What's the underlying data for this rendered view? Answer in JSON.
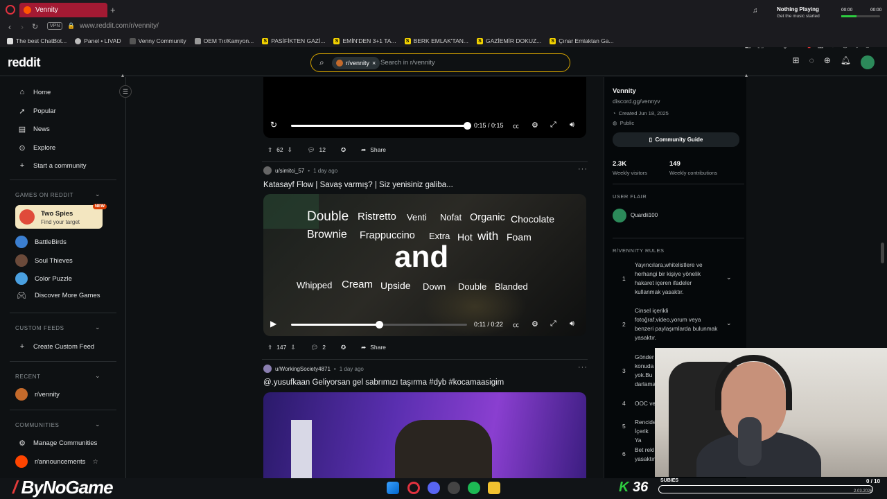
{
  "browser": {
    "tab_title": "Vennity",
    "url": "www.reddit.com/r/vennity/",
    "vpn": "VPN",
    "bookmarks": [
      "The best ChatBot...",
      "Panel • LIVAD",
      "Venny Community",
      "OEM Tır/Kamyon...",
      "PASİFİKTEN GAZİ...",
      "EMİN'DEN 3+1 TA...",
      "BERK EMLAK'TAN...",
      "GAZİEMİR DOKUZ...",
      "Çınar Emlaktan Ga..."
    ],
    "music_title": "Nothing Playing",
    "music_sub": "Get the music started",
    "music_time_left": "00:00",
    "music_time_right": "00:00"
  },
  "header": {
    "logo": "reddit",
    "search_chip": "r/vennity",
    "search_placeholder": "Search in r/vennity"
  },
  "sidebar": {
    "items": [
      "Home",
      "Popular",
      "News",
      "Explore",
      "Start a community"
    ],
    "games_header": "GAMES ON REDDIT",
    "featured_game": {
      "title": "Two Spies",
      "subtitle": "Find your target",
      "badge": "NEW"
    },
    "games": [
      "BattleBirds",
      "Soul Thieves",
      "Color Puzzle",
      "Discover More Games"
    ],
    "custom_feeds_header": "CUSTOM FEEDS",
    "create_custom_feed": "Create Custom Feed",
    "recent_header": "RECENT",
    "recent": [
      "r/vennity"
    ],
    "communities_header": "COMMUNITIES",
    "communities": [
      "Manage Communities",
      "r/announcements"
    ]
  },
  "posts": [
    {
      "video_time": "0:15 / 0:15",
      "progress": 1.0,
      "upvotes": "62",
      "comments": "12",
      "share": "Share"
    },
    {
      "author": "u/simitci_57",
      "time": "1 day ago",
      "title": "Katasayf Flow | Savaş varmış? | Siz yenisiniz galiba...",
      "video_words": {
        "row1": [
          "Double",
          "Ristretto",
          "Venti",
          "Nofat",
          "Organic",
          "Chocolate"
        ],
        "row2": [
          "Brownie",
          "Frappuccino",
          "Extra",
          "Hot",
          "with",
          "Foam"
        ],
        "center": "and",
        "row3": [
          "Whipped",
          "Cream",
          "Upside",
          "Down",
          "Double",
          "Blanded"
        ]
      },
      "video_time": "0:11 / 0:22",
      "progress": 0.5,
      "upvotes": "147",
      "comments": "2",
      "share": "Share"
    },
    {
      "author": "u/WorkingSociety4871",
      "time": "1 day ago",
      "title": "@.yusufkaan Geliyorsan gel sabrımızı taşırma #dyb #kocamaasigim"
    }
  ],
  "community": {
    "name": "Vennity",
    "link": "discord.gg/vennyv",
    "created": "Created Jun 18, 2025",
    "visibility": "Public",
    "guide_button": "Community Guide",
    "visitors": "2.3K",
    "visitors_label": "Weekly visitors",
    "contributions": "149",
    "contributions_label": "Weekly contributions",
    "user_flair_header": "USER FLAIR",
    "flair_user": "Quardii100",
    "rules_header": "R/VENNITY RULES",
    "rules": [
      {
        "num": "1",
        "text": "Yayıncılara,whitelistlere ve herhangi bir kişiye yönelik hakaret içeren ifadeler kullanmak yasaktır."
      },
      {
        "num": "2",
        "text": "Cinsel içerikli fotoğraf,video,yorum veya benzeri paylaşımlarda bulunmak yasaktır."
      },
      {
        "num": "3",
        "text": "Gönder konuda yok.Bu darlama"
      },
      {
        "num": "4",
        "text": "OOC ve"
      },
      {
        "num": "5",
        "text": "Rencide İçerik Ya"
      },
      {
        "num": "6",
        "text": "Bet rekl yasaktır"
      }
    ]
  },
  "overlay": {
    "brand": "ByNoGame",
    "counter": "36",
    "subs_label": "SUBIES",
    "subs_count": "0 / 10",
    "date": "2.03.2026"
  }
}
